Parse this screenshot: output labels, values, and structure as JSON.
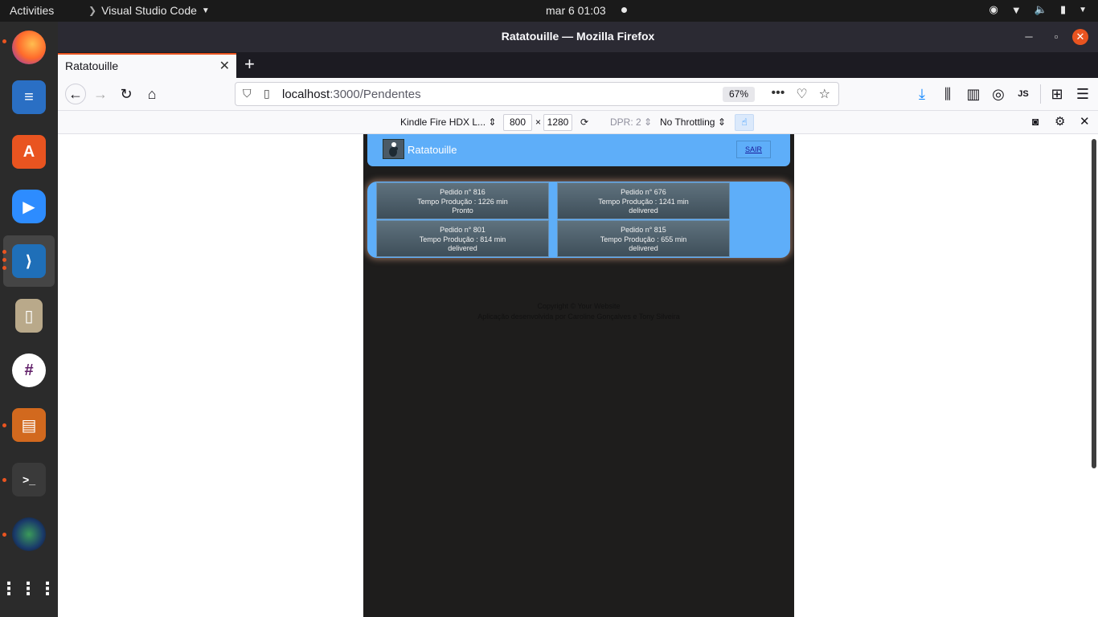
{
  "system": {
    "activities": "Activities",
    "app_menu": "Visual Studio Code",
    "clock": "mar 6  01:03"
  },
  "dock": {
    "items": [
      "firefox-icon",
      "writer-icon",
      "software-icon",
      "zoom-icon",
      "vscode-icon",
      "archive-icon",
      "slack-icon",
      "impress-icon",
      "terminal-icon",
      "camera-icon",
      "app-grid-icon"
    ]
  },
  "window": {
    "title": "Ratatouille — Mozilla Firefox"
  },
  "tab": {
    "label": "Ratatouille"
  },
  "urlbar": {
    "host": "localhost",
    "path": ":3000/Pendentes",
    "zoom": "67%"
  },
  "toolbar": {
    "profile": "JS"
  },
  "rdm": {
    "device": "Kindle Fire HDX L...",
    "width": "800",
    "times": "×",
    "height": "1280",
    "dpr": "DPR: 2",
    "throttling": "No Throttling"
  },
  "app": {
    "brand": "Ratatouille",
    "logout": "SAIR",
    "orders": [
      {
        "title": "Pedido n° 816",
        "time": "Tempo Produção : 1226 min",
        "status": "Pronto"
      },
      {
        "title": "Pedido n° 676",
        "time": "Tempo Produção : 1241 min",
        "status": "delivered"
      },
      {
        "title": "Pedido n° 801",
        "time": "Tempo Produção : 814 min",
        "status": "delivered"
      },
      {
        "title": "Pedido n° 815",
        "time": "Tempo Produção : 655 min",
        "status": "delivered"
      }
    ],
    "footer_line1": "Copyright © Your Website",
    "footer_line2": "Aplicação desenvolvida por Caroline Gonçalves e Tony Silveira"
  }
}
